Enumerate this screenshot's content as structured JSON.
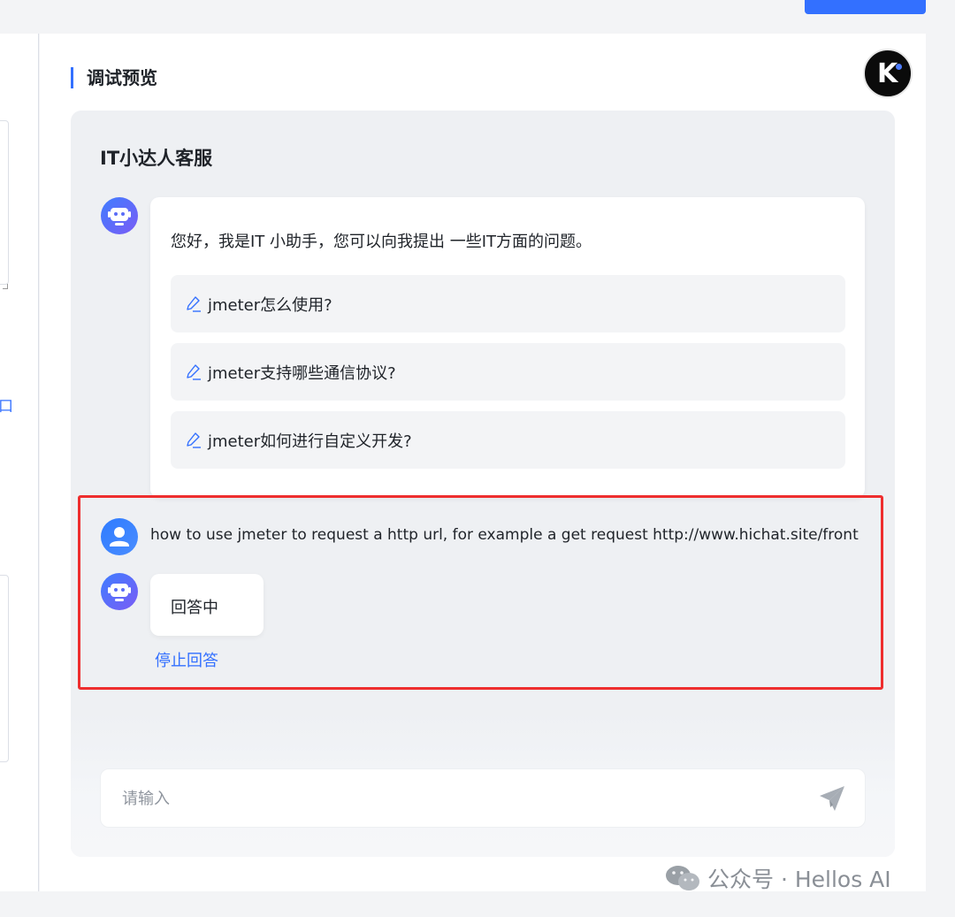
{
  "header": {
    "action_button_label": ""
  },
  "left_panel": {
    "link_fragment": "口"
  },
  "preview": {
    "section_title": "调试预览",
    "brand_logo_text": "K"
  },
  "chat": {
    "title": "IT小达人客服",
    "welcome": "您好，我是IT 小助手，您可以向我提出 一些IT方面的问题。",
    "suggestions": [
      {
        "label": "jmeter怎么使用?",
        "icon": "pencil-icon"
      },
      {
        "label": "jmeter支持哪些通信协议?",
        "icon": "pencil-icon"
      },
      {
        "label": "jmeter如何进行自定义开发?",
        "icon": "pencil-icon"
      }
    ],
    "user_message": "how to use jmeter to request a http url, for example a get request http://www.hichat.site/front",
    "answer_status": "回答中",
    "stop_label": "停止回答",
    "input_placeholder": "请输入"
  },
  "watermark": {
    "text": "公众号 · Hellos AI"
  },
  "colors": {
    "accent": "#3370ff",
    "highlight_border": "#ee2e2e",
    "card_bg": "#eef0f3"
  }
}
